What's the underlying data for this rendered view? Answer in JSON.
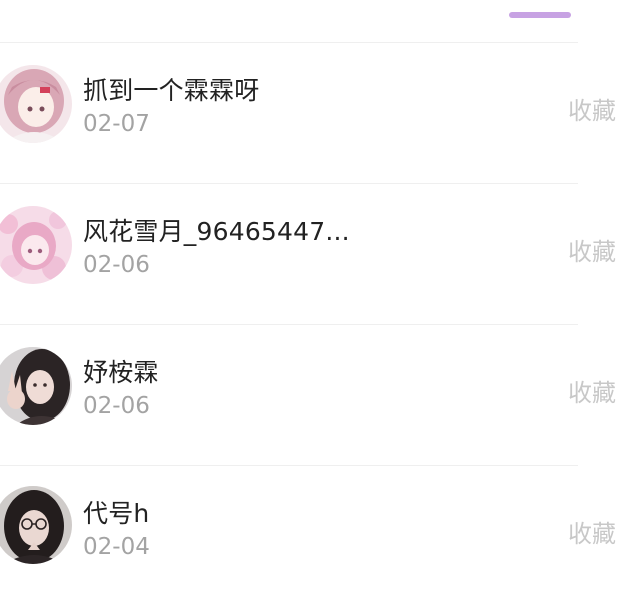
{
  "tab_indicator_color": "#c7a2e3",
  "action_label": "收藏",
  "items": [
    {
      "name": "抓到一个霖霖呀",
      "date": "02-07",
      "avatar_icon": "anime-girl-pink-hair-avatar"
    },
    {
      "name": "风花雪月_96465447...",
      "date": "02-06",
      "avatar_icon": "anime-girl-pink-floral-avatar"
    },
    {
      "name": "妤桉霖",
      "date": "02-06",
      "avatar_icon": "girl-peace-sign-photo-avatar"
    },
    {
      "name": "代号h",
      "date": "02-04",
      "avatar_icon": "girl-glasses-photo-avatar"
    }
  ]
}
